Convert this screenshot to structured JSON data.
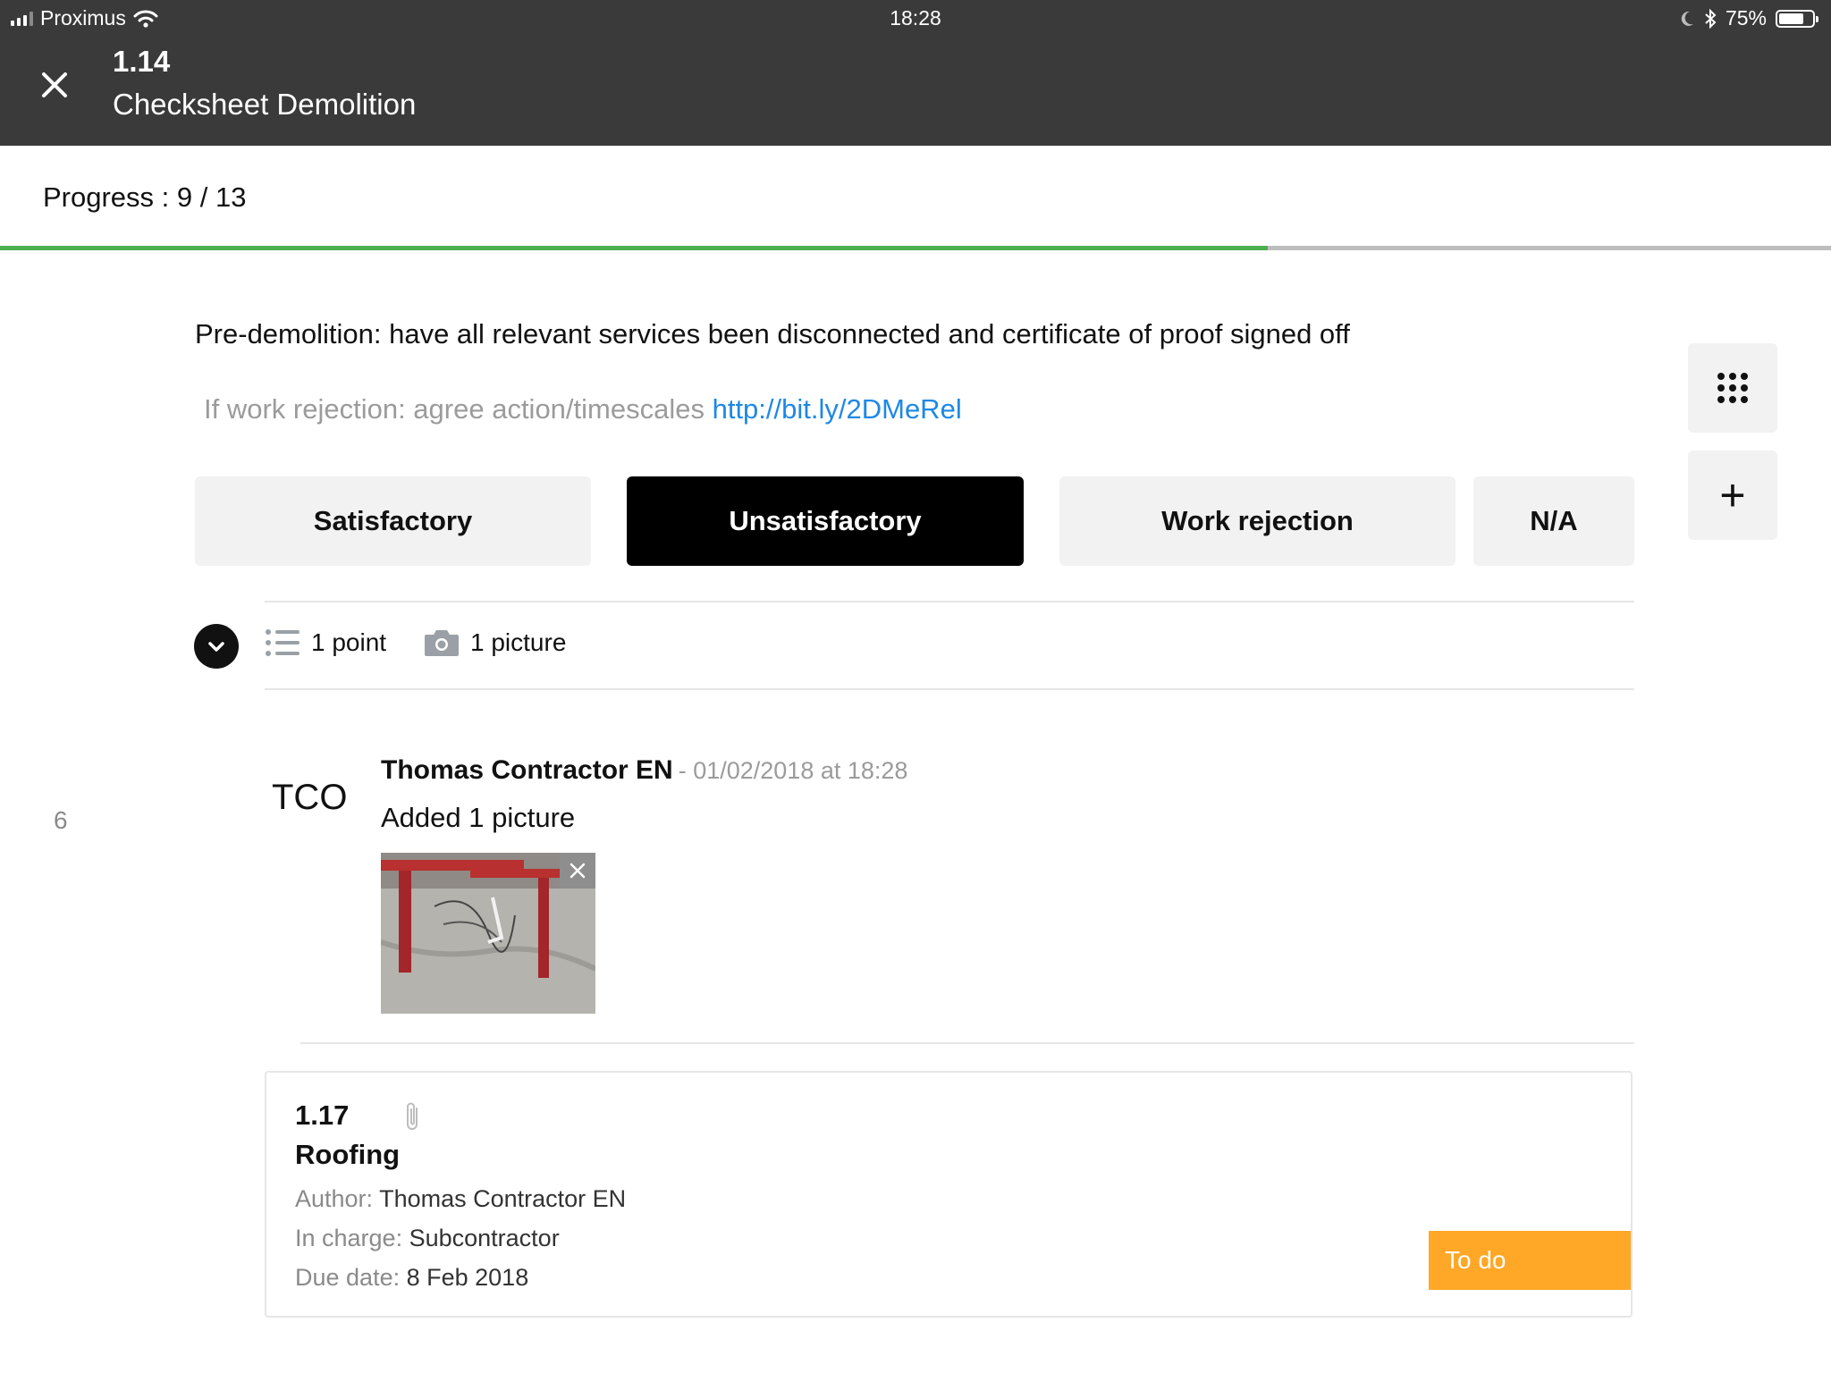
{
  "status_bar": {
    "carrier": "Proximus",
    "time": "18:28",
    "battery": "75%",
    "battery_level": 0.75
  },
  "header": {
    "code": "1.14",
    "title": "Checksheet Demolition"
  },
  "progress": {
    "label": "Progress : 9 / 13",
    "done": 9,
    "total": 13
  },
  "question": {
    "text": "Pre-demolition: have all relevant services been disconnected and certificate of proof signed off",
    "hint_prefix": "If work rejection: agree action/timescales",
    "hint_link": "http://bit.ly/2DMeRel"
  },
  "answers": [
    {
      "label": "Satisfactory",
      "selected": false
    },
    {
      "label": "Unsatisfactory",
      "selected": true
    },
    {
      "label": "Work rejection",
      "selected": false
    },
    {
      "label": "N/A",
      "selected": false
    }
  ],
  "summary": {
    "points": "1 point",
    "pictures": "1 picture"
  },
  "comment": {
    "row_number": "6",
    "avatar": "TCO",
    "author": "Thomas Contractor EN",
    "timestamp": "- 01/02/2018 at 18:28",
    "text": "Added 1 picture"
  },
  "task": {
    "code": "1.17",
    "title": "Roofing",
    "author_label": "Author:",
    "author": "Thomas Contractor EN",
    "in_charge_label": "In charge:",
    "in_charge": "Subcontractor",
    "due_label": "Due date:",
    "due": "8 Feb 2018",
    "status": "To do"
  },
  "colors": {
    "header_bg": "#3a3a3a",
    "progress_done": "#4caf50",
    "progress_track": "#bdbdbd",
    "link": "#1e88e5",
    "status_todo": "#ffa726"
  },
  "icons": [
    "close-icon",
    "grid-dots-icon",
    "plus-icon",
    "chevron-down-icon",
    "list-icon",
    "camera-icon",
    "remove-icon",
    "paperclip-icon",
    "wifi-icon",
    "moon-icon",
    "bluetooth-icon",
    "battery-icon"
  ]
}
